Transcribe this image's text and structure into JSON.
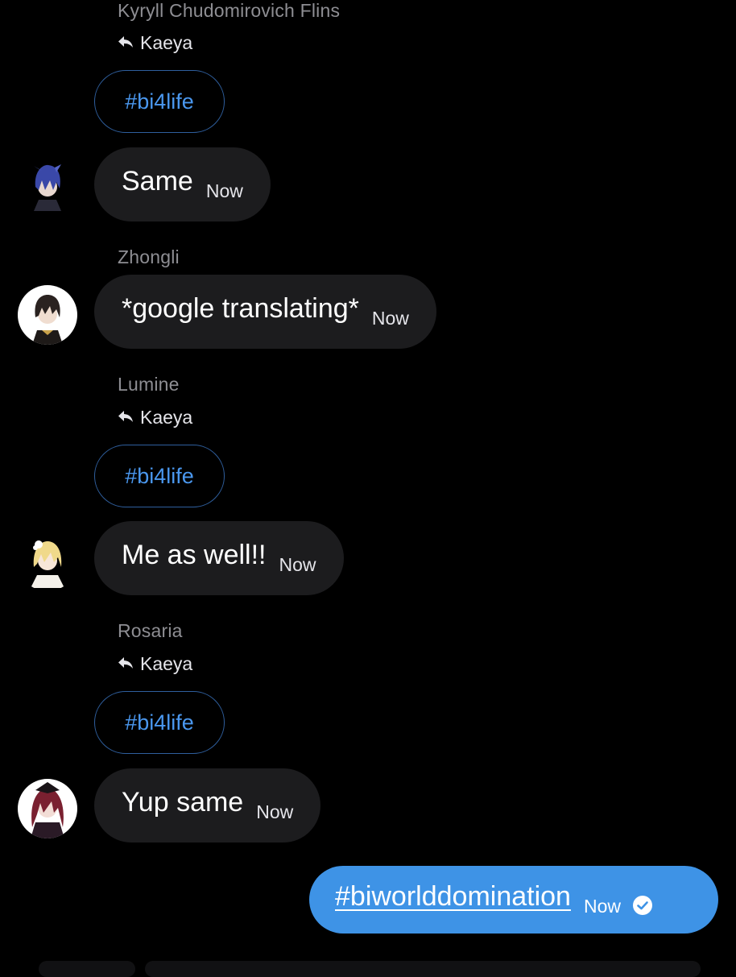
{
  "colors": {
    "background": "#000000",
    "incoming_bubble": "#1c1c1e",
    "outgoing_bubble": "#3e93e6",
    "link_blue": "#4a97ee",
    "sender_gray": "#8e8e93"
  },
  "thread": [
    {
      "sender": "Kyryll Chudomirovich Flins",
      "reply_to": "Kaeya",
      "quoted": "#bi4life",
      "text": "Same",
      "time": "Now"
    },
    {
      "sender": "Zhongli",
      "text": "*google translating*",
      "time": "Now"
    },
    {
      "sender": "Lumine",
      "reply_to": "Kaeya",
      "quoted": "#bi4life",
      "text": "Me as well!!",
      "time": "Now"
    },
    {
      "sender": "Rosaria",
      "reply_to": "Kaeya",
      "quoted": "#bi4life",
      "text": "Yup same",
      "time": "Now"
    }
  ],
  "outgoing": {
    "text": "#biworlddomination",
    "time": "Now",
    "status_icon": "read-check-icon"
  },
  "icons": {
    "reply": "reply-arrow-icon",
    "check": "check-circle-icon"
  }
}
